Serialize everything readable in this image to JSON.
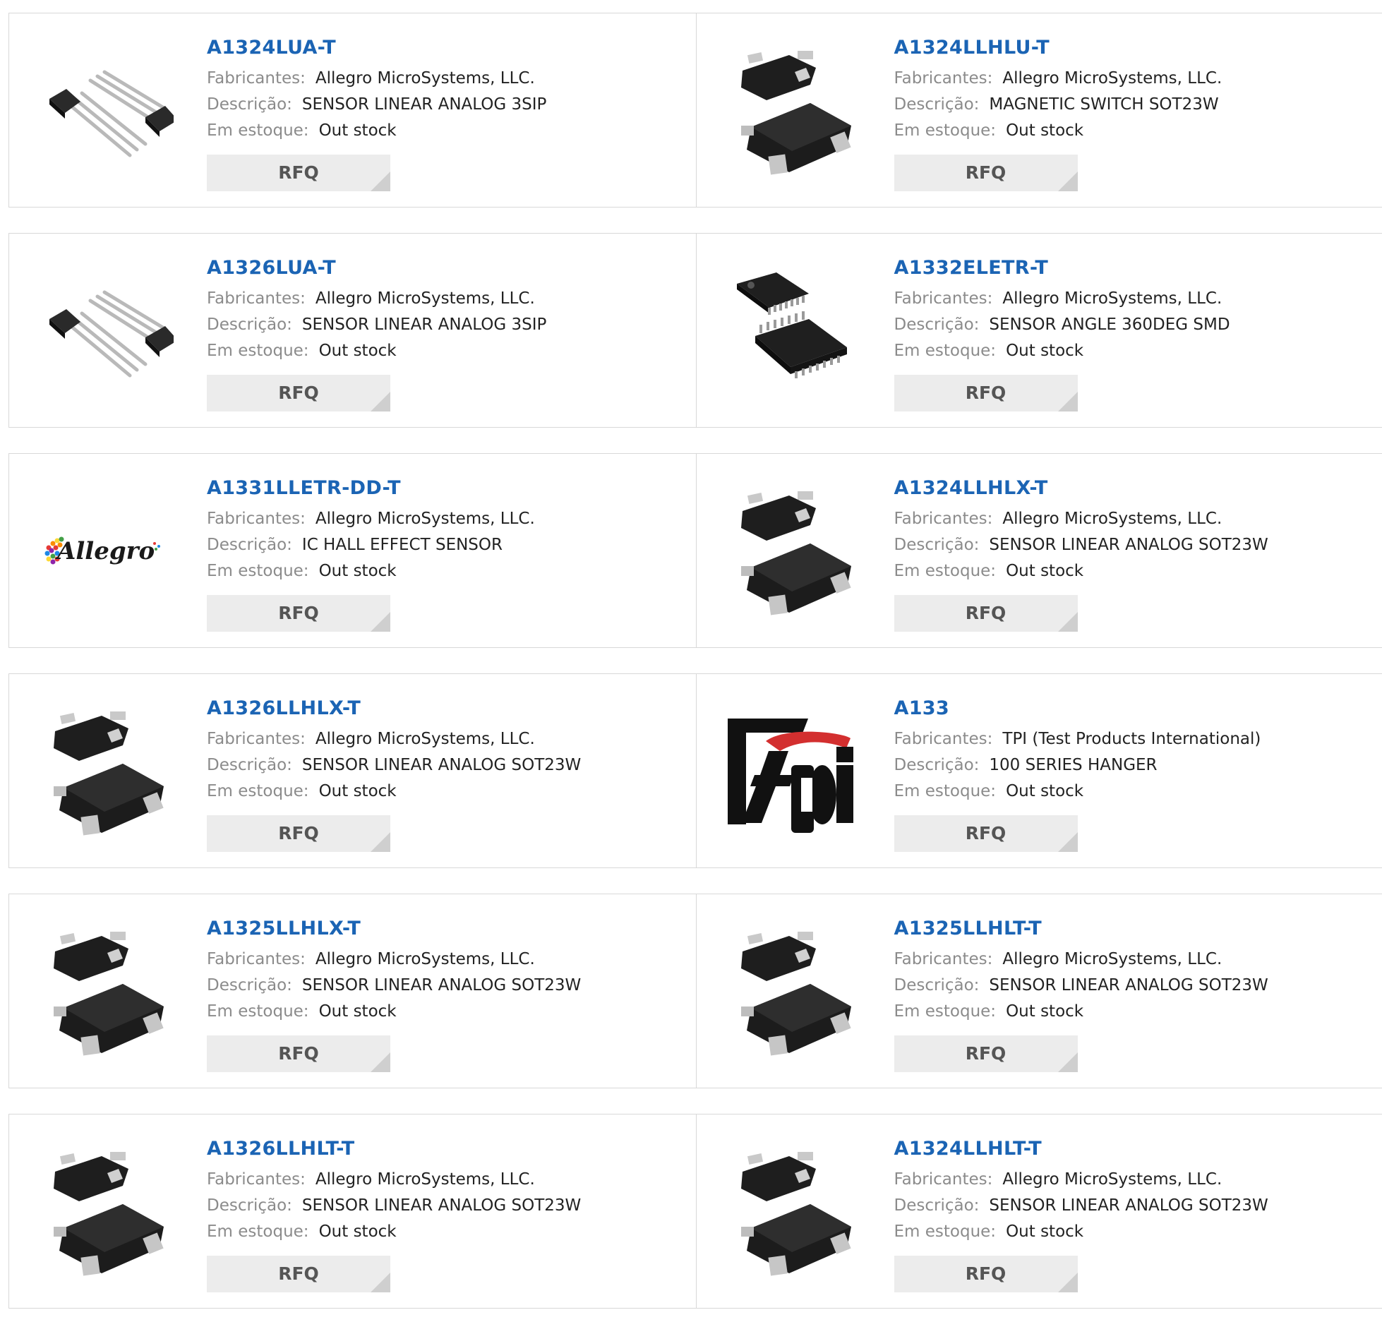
{
  "labels": {
    "manufacturer": "Fabricantes:",
    "description": "Descrição:",
    "stock": "Em estoque:",
    "rfq": "RFQ"
  },
  "products": [
    {
      "part": "A1324LUA-T",
      "manufacturer": "Allegro MicroSystems, LLC.",
      "description": "SENSOR LINEAR ANALOG 3SIP",
      "stock": "Out stock",
      "image": "sip3"
    },
    {
      "part": "A1324LLHLU-T",
      "manufacturer": "Allegro MicroSystems, LLC.",
      "description": "MAGNETIC SWITCH SOT23W",
      "stock": "Out stock",
      "image": "sot23"
    },
    {
      "part": "A1326LUA-T",
      "manufacturer": "Allegro MicroSystems, LLC.",
      "description": "SENSOR LINEAR ANALOG 3SIP",
      "stock": "Out stock",
      "image": "sip3"
    },
    {
      "part": "A1332ELETR-T",
      "manufacturer": "Allegro MicroSystems, LLC.",
      "description": "SENSOR ANGLE 360DEG SMD",
      "stock": "Out stock",
      "image": "tssop"
    },
    {
      "part": "A1331LLETR-DD-T",
      "manufacturer": "Allegro MicroSystems, LLC.",
      "description": "IC HALL EFFECT SENSOR",
      "stock": "Out stock",
      "image": "allegro-logo",
      "logo_text": "Allegro"
    },
    {
      "part": "A1324LLHLX-T",
      "manufacturer": "Allegro MicroSystems, LLC.",
      "description": "SENSOR LINEAR ANALOG SOT23W",
      "stock": "Out stock",
      "image": "sot23"
    },
    {
      "part": "A1326LLHLX-T",
      "manufacturer": "Allegro MicroSystems, LLC.",
      "description": "SENSOR LINEAR ANALOG SOT23W",
      "stock": "Out stock",
      "image": "sot23"
    },
    {
      "part": "A133",
      "manufacturer": "TPI (Test Products International)",
      "description": "100 SERIES HANGER",
      "stock": "Out stock",
      "image": "tpi-logo",
      "logo_text": "tpi"
    },
    {
      "part": "A1325LLHLX-T",
      "manufacturer": "Allegro MicroSystems, LLC.",
      "description": "SENSOR LINEAR ANALOG SOT23W",
      "stock": "Out stock",
      "image": "sot23"
    },
    {
      "part": "A1325LLHLT-T",
      "manufacturer": "Allegro MicroSystems, LLC.",
      "description": "SENSOR LINEAR ANALOG SOT23W",
      "stock": "Out stock",
      "image": "sot23"
    },
    {
      "part": "A1326LLHLT-T",
      "manufacturer": "Allegro MicroSystems, LLC.",
      "description": "SENSOR LINEAR ANALOG SOT23W",
      "stock": "Out stock",
      "image": "sot23"
    },
    {
      "part": "A1324LLHLT-T",
      "manufacturer": "Allegro MicroSystems, LLC.",
      "description": "SENSOR LINEAR ANALOG SOT23W",
      "stock": "Out stock",
      "image": "sot23"
    }
  ],
  "colors": {
    "part_link": "#1b64b4",
    "label": "#8b8b8b",
    "value": "#222222",
    "button_bg": "#ececec",
    "border": "#d8d8d8"
  }
}
